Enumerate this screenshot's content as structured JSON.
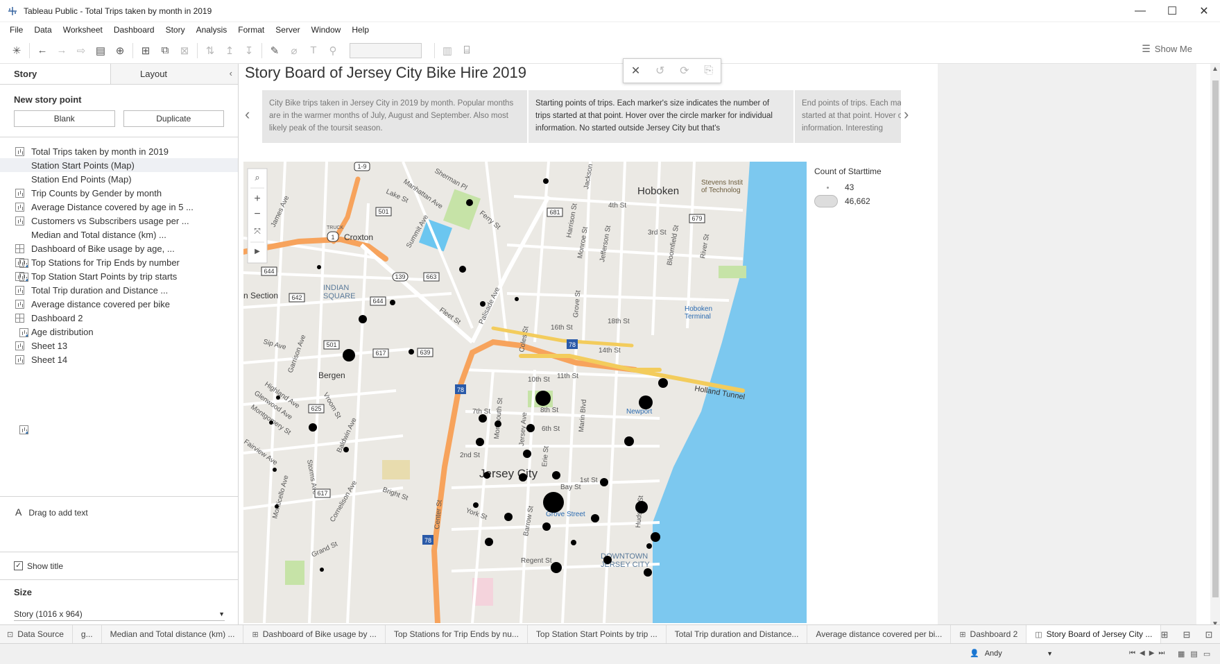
{
  "window": {
    "title": "Tableau Public - Total Trips taken by month in 2019",
    "minimize": "—",
    "maximize": "☐",
    "close": "✕"
  },
  "menu": [
    "File",
    "Data",
    "Worksheet",
    "Dashboard",
    "Story",
    "Analysis",
    "Format",
    "Server",
    "Window",
    "Help"
  ],
  "toolbar": {
    "show_me": "Show Me"
  },
  "left_pane": {
    "tab_story": "Story",
    "tab_layout": "Layout",
    "new_story_point": "New story point",
    "blank": "Blank",
    "duplicate": "Duplicate",
    "sheets": [
      {
        "label": "Total Trips taken by month in 2019",
        "type": "worksheet"
      },
      {
        "label": "Station Start Points (Map)",
        "type": "map"
      },
      {
        "label": "Station End Points (Map)",
        "type": "map"
      },
      {
        "label": "Trip Counts by Gender by month",
        "type": "worksheet"
      },
      {
        "label": "Average Distance covered by age in 5 ...",
        "type": "worksheet"
      },
      {
        "label": "Customers vs Subscribers usage per ...",
        "type": "worksheet"
      },
      {
        "label": "Median and Total distance (km) ...",
        "type": "map"
      },
      {
        "label": "Dashboard of  Bike usage by age, ...",
        "type": "dashboard"
      },
      {
        "label": "Top Stations for Trip Ends by number",
        "type": "worksheet"
      },
      {
        "label": "Top Station Start Points by trip starts",
        "type": "worksheet"
      },
      {
        "label": "Total Trip duration and Distance ...",
        "type": "worksheet"
      },
      {
        "label": "Average distance covered per bike",
        "type": "worksheet"
      },
      {
        "label": "Dashboard 2",
        "type": "dashboard"
      },
      {
        "label": "Age distribution",
        "type": "map"
      },
      {
        "label": "Sheet 13",
        "type": "worksheet"
      },
      {
        "label": "Sheet 14",
        "type": "worksheet"
      }
    ],
    "drag_to_add_text": "Drag to add text",
    "show_title": "Show title",
    "size_heading": "Size",
    "size_value": "Story (1016 x 964)"
  },
  "story": {
    "title": "Story Board of Jersey City Bike Hire 2019",
    "points": [
      "City Bike trips taken in Jersey City in 2019 by month. Popular months are in the warmer months of July, August and September. Also most likely peak of the toursit season.",
      "Starting points of trips. Each marker's size indicates the number of trips started at that point. Hover over the circle marker for individual information. No started outside Jersey City but that's",
      "End points of trips. Each marker's size indicates the number of trips started at that point. Hover over the circle marker for individual information. Interesting"
    ],
    "legend_title": "Count of Starttime",
    "legend_min": "43",
    "legend_max": "46,662"
  },
  "map": {
    "labels": {
      "hoboken": "Hoboken",
      "jersey_city": "Jersey City",
      "bergen": "Bergen",
      "croxton": "Croxton",
      "indian_square": "INDIAN\nSQUARE",
      "section": "n Section",
      "downtown": "DOWNTOWN\nJERSEY CITY",
      "stevens": "Stevens Instit\nof Technolog",
      "hoboken_terminal": "Hoboken\nTerminal",
      "holland_tunnel": "Holland Tunnel",
      "newport": "Newport",
      "grove_street": "Grove Street",
      "truck": "TRUCK"
    },
    "streets": [
      "Manhattan Ave",
      "Sherman Pl",
      "Lake St",
      "Ferry St",
      "James Ave",
      "Summit Ave",
      "Jackson St",
      "4th St",
      "Harrison St",
      "Monroe St",
      "Jefferson St",
      "3rd St",
      "Bloomfield St",
      "River St",
      "Palisade Ave",
      "Fleet St",
      "Grove St",
      "16th St",
      "18th St",
      "14th St",
      "Coles St",
      "Sip Ave",
      "Garrison Ave",
      "11th St",
      "10th St",
      "Highland Ave",
      "Glenwood Ave",
      "Vroom St",
      "Montgomery St",
      "8th St",
      "7th St",
      "6th St",
      "2nd St",
      "1st St",
      "Bay St",
      "Marin Blvd",
      "Erie St",
      "Baldwin Ave",
      "Storms Ave",
      "Bright St",
      "York St",
      "Barrow St",
      "Center St",
      "Monticello Ave",
      "Fairview Ave",
      "Cornelison Ave",
      "Grand St",
      "Regent St",
      "Jersey Ave",
      "Monmouth St",
      "Hudson St"
    ],
    "shields": [
      "1-9",
      "501",
      "681",
      "679",
      "1",
      "644",
      "139",
      "663",
      "642",
      "644",
      "501",
      "617",
      "639",
      "78",
      "78",
      "625",
      "617",
      "78"
    ]
  },
  "sheet_tabs": [
    {
      "label": "Data Source",
      "icon": "db"
    },
    {
      "label": "g...",
      "icon": ""
    },
    {
      "label": "Median and Total distance (km) ...",
      "icon": ""
    },
    {
      "label": "Dashboard of  Bike usage by ...",
      "icon": "dash"
    },
    {
      "label": "Top Stations for Trip Ends by nu...",
      "icon": ""
    },
    {
      "label": "Top Station Start Points by trip ...",
      "icon": ""
    },
    {
      "label": "Total Trip duration and Distance...",
      "icon": ""
    },
    {
      "label": "Average distance covered per bi...",
      "icon": ""
    },
    {
      "label": "Dashboard 2",
      "icon": "dash"
    },
    {
      "label": "Story Board of Jersey City ...",
      "icon": "story"
    }
  ],
  "status": {
    "user": "Andy"
  }
}
